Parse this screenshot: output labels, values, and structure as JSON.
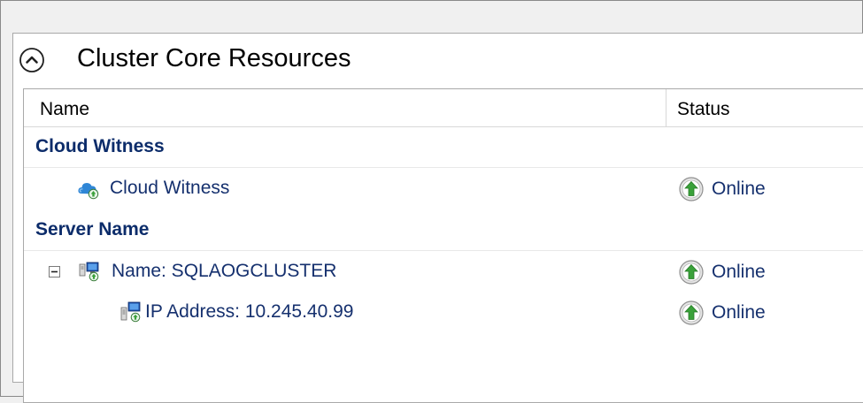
{
  "section": {
    "title": "Cluster Core Resources",
    "collapse_icon": "chevron-up-circle-icon"
  },
  "columns": {
    "name": "Name",
    "status": "Status"
  },
  "groups": [
    {
      "label": "Cloud Witness",
      "items": [
        {
          "label": "Cloud Witness",
          "icon": "cloud-witness-icon",
          "status": "Online",
          "status_icon": "online-arrow-up-icon"
        }
      ]
    },
    {
      "label": "Server Name",
      "items": [
        {
          "label": "Name: SQLAOGCLUSTER",
          "icon": "cluster-name-icon",
          "expander": "collapse-minus-icon",
          "status": "Online",
          "status_icon": "online-arrow-up-icon"
        },
        {
          "label": "IP Address: 10.245.40.99",
          "icon": "ip-address-icon",
          "status": "Online",
          "status_icon": "online-arrow-up-icon"
        }
      ]
    }
  ],
  "colors": {
    "group_text": "#0c2c6a",
    "item_text": "#15306e",
    "online_green": "#3aa13a"
  }
}
